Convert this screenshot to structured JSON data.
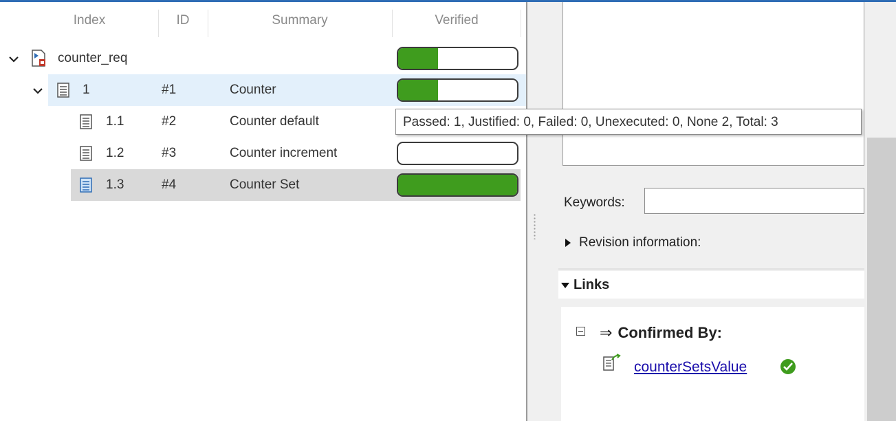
{
  "table": {
    "columns": [
      "Index",
      "ID",
      "Summary",
      "Verified"
    ],
    "rows": [
      {
        "index": "counter_req",
        "id": "",
        "summary": "",
        "verified_fraction": 0.333
      },
      {
        "index": "1",
        "id": "#1",
        "summary": "Counter",
        "verified_fraction": 0.333
      },
      {
        "index": "1.1",
        "id": "#2",
        "summary": "Counter default",
        "verified_fraction": null
      },
      {
        "index": "1.2",
        "id": "#3",
        "summary": "Counter increment",
        "verified_fraction": 0
      },
      {
        "index": "1.3",
        "id": "#4",
        "summary": "Counter Set",
        "verified_fraction": 1.0
      }
    ]
  },
  "tooltip": {
    "text": "Passed: 1, Justified: 0, Failed: 0, Unexecuted: 0, None 2, Total: 3"
  },
  "details": {
    "keywords_label": "Keywords:",
    "keywords_value": "",
    "revision_label": "Revision information:",
    "links_header": "Links",
    "confirmed_by_label": "Confirmed By:",
    "link_name": "counterSetsValue"
  },
  "colors": {
    "verified_green": "#3f9c1e",
    "selection_light": "#e3f0fb",
    "selection_grey": "#d9d9d9",
    "link_blue": "#1a0dab"
  },
  "icons": {
    "expand": "chevron-down-icon",
    "requirement_set": "requirement-set-icon",
    "requirement": "document-icon",
    "link_item": "test-link-icon",
    "status": "check-circle-icon"
  }
}
